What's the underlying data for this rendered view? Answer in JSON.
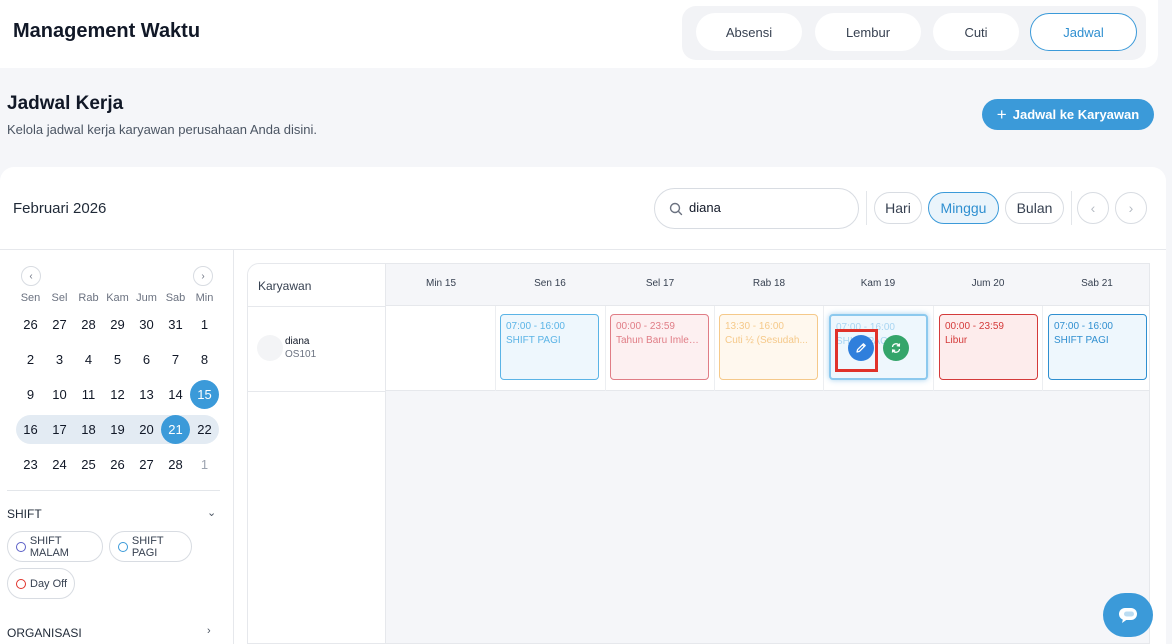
{
  "app": {
    "title": "Management Waktu"
  },
  "tabs": [
    {
      "label": "Absensi",
      "active": false
    },
    {
      "label": "Lembur",
      "active": false
    },
    {
      "label": "Cuti",
      "active": false
    },
    {
      "label": "Jadwal",
      "active": true
    }
  ],
  "page": {
    "title": "Jadwal Kerja",
    "subtitle": "Kelola jadwal kerja karyawan perusahaan Anda disini.",
    "add_button": "Jadwal ke Karyawan"
  },
  "toolbar": {
    "month": "Februari 2026",
    "search_value": "diana",
    "views": [
      "Hari",
      "Minggu",
      "Bulan"
    ],
    "active_view": "Minggu"
  },
  "mini_calendar": {
    "weekdays": [
      "Sen",
      "Sel",
      "Rab",
      "Kam",
      "Jum",
      "Sab",
      "Min"
    ],
    "weeks": [
      [
        "26",
        "27",
        "28",
        "29",
        "30",
        "31",
        "1"
      ],
      [
        "2",
        "3",
        "4",
        "5",
        "6",
        "7",
        "8"
      ],
      [
        "9",
        "10",
        "11",
        "12",
        "13",
        "14",
        "15"
      ],
      [
        "16",
        "17",
        "18",
        "19",
        "20",
        "21",
        "22"
      ],
      [
        "23",
        "24",
        "25",
        "26",
        "27",
        "28",
        "1"
      ]
    ]
  },
  "filters": {
    "shift_label": "SHIFT",
    "shift_chips": [
      {
        "label": "SHIFT MALAM",
        "color": "#5b5fc7"
      },
      {
        "label": "SHIFT PAGI",
        "color": "#3b9ad9"
      },
      {
        "label": "Day Off",
        "color": "#e0322a"
      }
    ],
    "org_label": "ORGANISASI"
  },
  "schedule": {
    "employee_header": "Karyawan",
    "days": [
      "Min 15",
      "Sen 16",
      "Sel 17",
      "Rab 18",
      "Kam 19",
      "Jum 20",
      "Sab 21"
    ],
    "employee": {
      "name": "diana",
      "code": "OS101"
    },
    "shifts": [
      {
        "time": "07:00 - 16:00",
        "name": "SHIFT PAGI",
        "color": "#5bb4e6",
        "bg": "#eef7fd"
      },
      {
        "time": "00:00 - 23:59",
        "name": "Tahun Baru Imlek ...",
        "color": "#e07d86",
        "bg": "#fdf0f1"
      },
      {
        "time": "13:30 - 16:00",
        "name": "Cuti ½ (Sesudah...",
        "color": "#f5c98a",
        "bg": "#fff8ee"
      },
      {
        "time": "07:00 - 16:00",
        "name": "SHIFT PAGI",
        "color": "#5bb4e6",
        "bg": "#eef7fd"
      },
      {
        "time": "00:00 - 23:59",
        "name": "Libur",
        "color": "#d43a3a",
        "bg": "#fdecec"
      },
      {
        "time": "07:00 - 16:00",
        "name": "SHIFT PAGI",
        "color": "#2f8fd0",
        "bg": "#eef7fd"
      }
    ]
  },
  "colors": {
    "accent": "#3b9ad9",
    "edit_action": "#2f7fdc",
    "swap_action": "#34a56a",
    "highlight": "#e0322a"
  }
}
